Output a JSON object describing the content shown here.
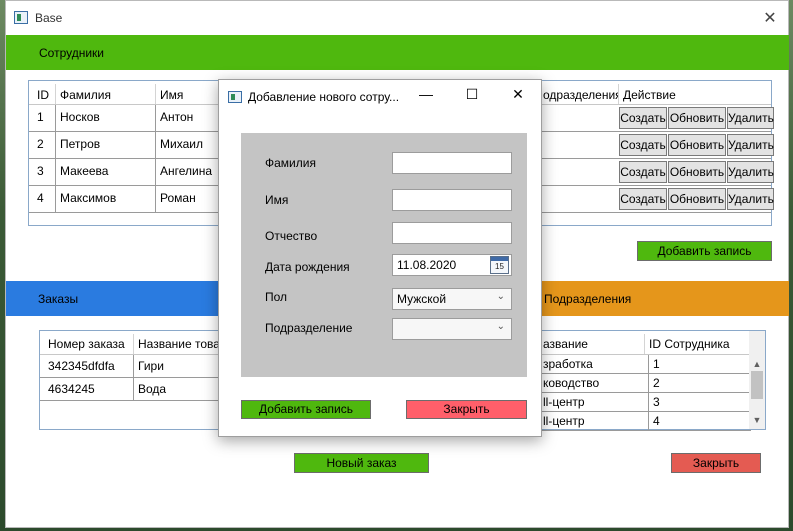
{
  "window": {
    "title": "Base"
  },
  "employees": {
    "header": "Сотрудники",
    "columns": [
      "ID",
      "Фамилия",
      "Имя",
      "одразделения",
      "Действие"
    ],
    "rows": [
      {
        "id": "1",
        "last": "Носков",
        "first": "Антон"
      },
      {
        "id": "2",
        "last": "Петров",
        "first": "Михаил"
      },
      {
        "id": "3",
        "last": "Макеева",
        "first": "Ангелина"
      },
      {
        "id": "4",
        "last": "Максимов",
        "first": "Роман"
      }
    ],
    "actions": {
      "create": "Создать",
      "update": "Обновить",
      "delete": "Удалить"
    },
    "add_button": "Добавить запись"
  },
  "orders": {
    "header": "Заказы",
    "columns": [
      "Номер заказа",
      "Название товар"
    ],
    "rows": [
      {
        "num": "342345dfdfa",
        "name": "Гири"
      },
      {
        "num": "4634245",
        "name": "Вода"
      }
    ],
    "new_button": "Новый заказ"
  },
  "departments": {
    "header": "Подразделения",
    "columns": [
      "азвание",
      "ID Сотрудника"
    ],
    "rows": [
      {
        "name": "зработка",
        "emp_id": "1"
      },
      {
        "name": "ководство",
        "emp_id": "2"
      },
      {
        "name": "ll-центр",
        "emp_id": "3"
      },
      {
        "name": "ll-центр",
        "emp_id": "4"
      }
    ],
    "close_button": "Закрыть"
  },
  "dialog": {
    "title": "Добавление нового сотру...",
    "labels": {
      "last_name": "Фамилия",
      "first_name": "Имя",
      "patronymic": "Отчество",
      "birth_date": "Дата рождения",
      "gender": "Пол",
      "department": "Подразделение"
    },
    "values": {
      "birth_date": "11.08.2020",
      "calendar_day": "15",
      "gender": "Мужской"
    },
    "add_button": "Добавить запись",
    "close_button": "Закрыть"
  },
  "colors": {
    "green": "#4fb80e",
    "blue": "#2a7be0",
    "orange": "#e5961b",
    "red": "#e45b52",
    "pink": "#ff5f6a"
  }
}
